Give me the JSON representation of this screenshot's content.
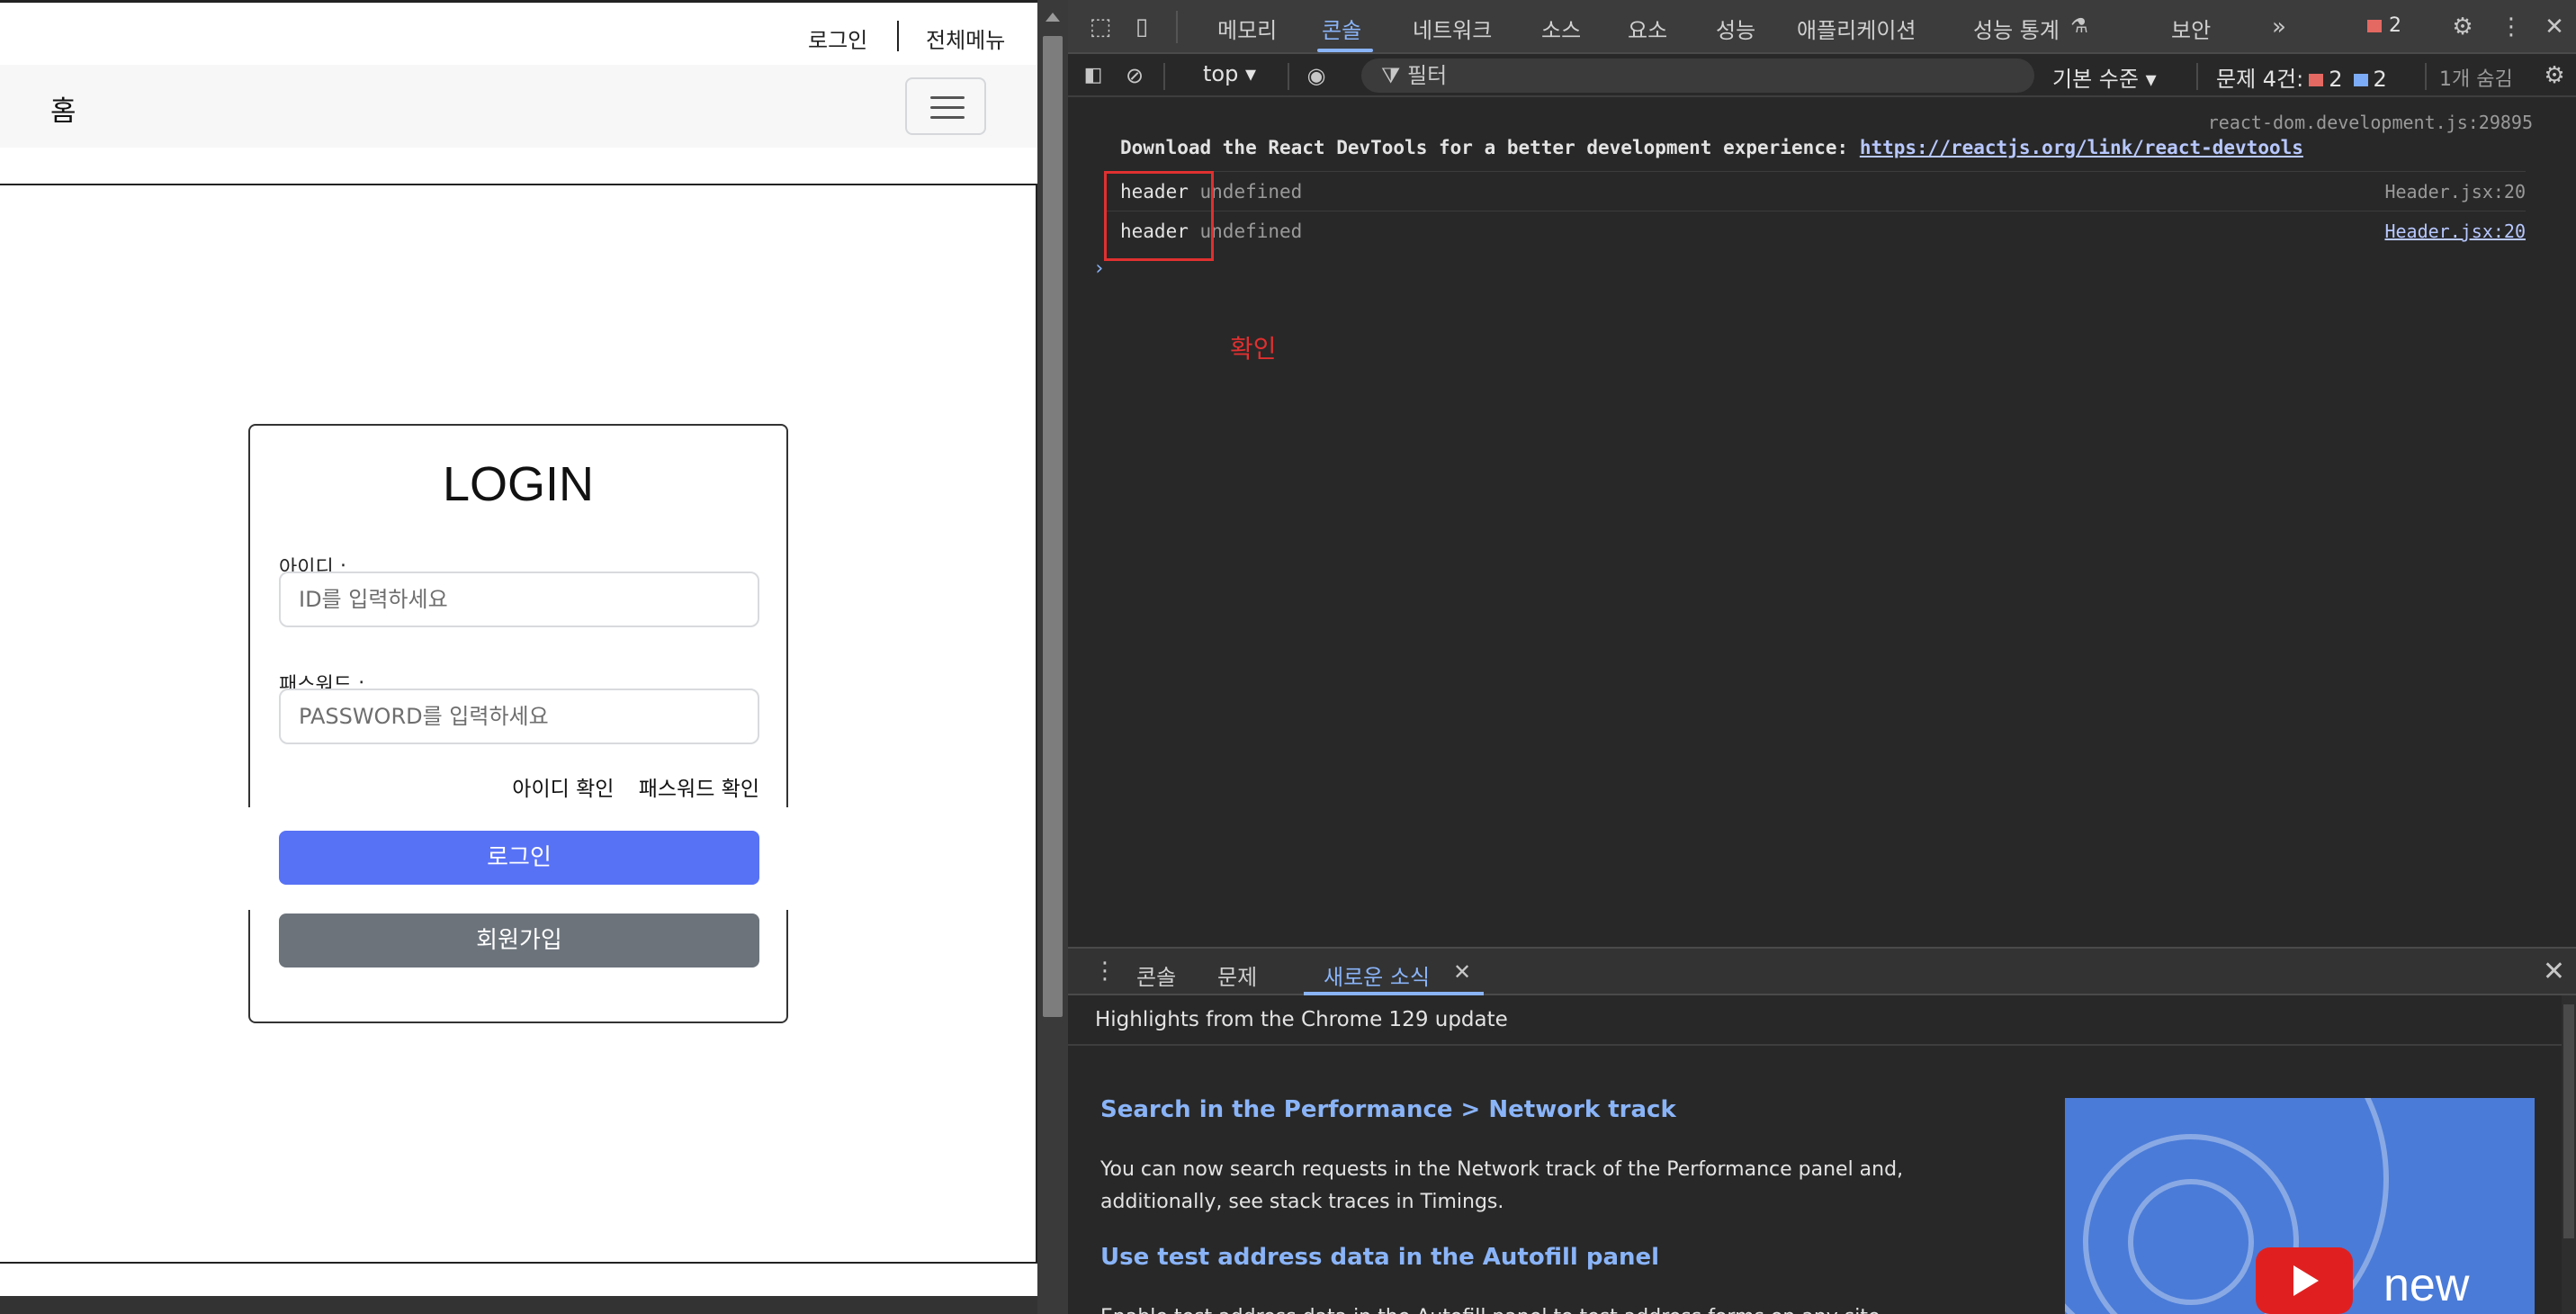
{
  "page": {
    "util_links": {
      "login": "로그인",
      "all_menu": "전체메뉴"
    },
    "navbar": {
      "home": "홈",
      "toggler_icon": "hamburger-icon"
    },
    "login_form": {
      "title": "LOGIN",
      "id_label": "아이디 :",
      "id_placeholder": "ID를 입력하세요",
      "pw_label": "패스워드 :",
      "pw_placeholder": "PASSWORD를 입력하세요",
      "find_id": "아이디 확인",
      "find_pw": "패스워드 확인",
      "login_button": "로그인",
      "signup_button": "회원가입",
      "colors": {
        "login": "#5872f5",
        "signup": "#6c737b"
      }
    }
  },
  "devtools": {
    "tabs": [
      "메모리",
      "콘솔",
      "네트워크",
      "소스",
      "요소",
      "성능",
      "애플리케이션",
      "성능 통계",
      "보안"
    ],
    "active_tab": "콘솔",
    "more_tabs_icon": "chevron-double-right-icon",
    "error_badge_count": "2",
    "toolbar": {
      "context": "top",
      "filter_placeholder": "필터",
      "level": "기본 수준",
      "issues_label": "문제 4건:",
      "issues_errors": "2",
      "issues_info": "2",
      "hidden": "1개 숨김"
    },
    "console": {
      "react_source": "react-dom.development.js:29895",
      "devtools_message": "Download the React DevTools for a better development experience: ",
      "devtools_link": "https://reactjs.org/link/react-devtools",
      "logs": [
        {
          "label": "header",
          "value": "undefined",
          "source": "Header.jsx:20"
        },
        {
          "label": "header",
          "value": "undefined",
          "source": "Header.jsx:20"
        }
      ],
      "prompt": "›",
      "annotation": "확인",
      "annotation_color": "#e03030"
    },
    "drawer": {
      "tabs": [
        "콘솔",
        "문제",
        "새로운 소식"
      ],
      "active_tab": "새로운 소식",
      "header": "Highlights from the Chrome 129 update",
      "items": [
        {
          "title": "Search in the Performance > Network track",
          "body": "You can now search requests in the Network track of the Performance panel and, additionally, see stack traces in Timings."
        },
        {
          "title": "Use test address data in the Autofill panel",
          "body": "Enable test address data in the Autofill panel to test address forms on any site."
        }
      ],
      "thumbnail_text": "new"
    },
    "accent_color": "#8ab4f8"
  }
}
